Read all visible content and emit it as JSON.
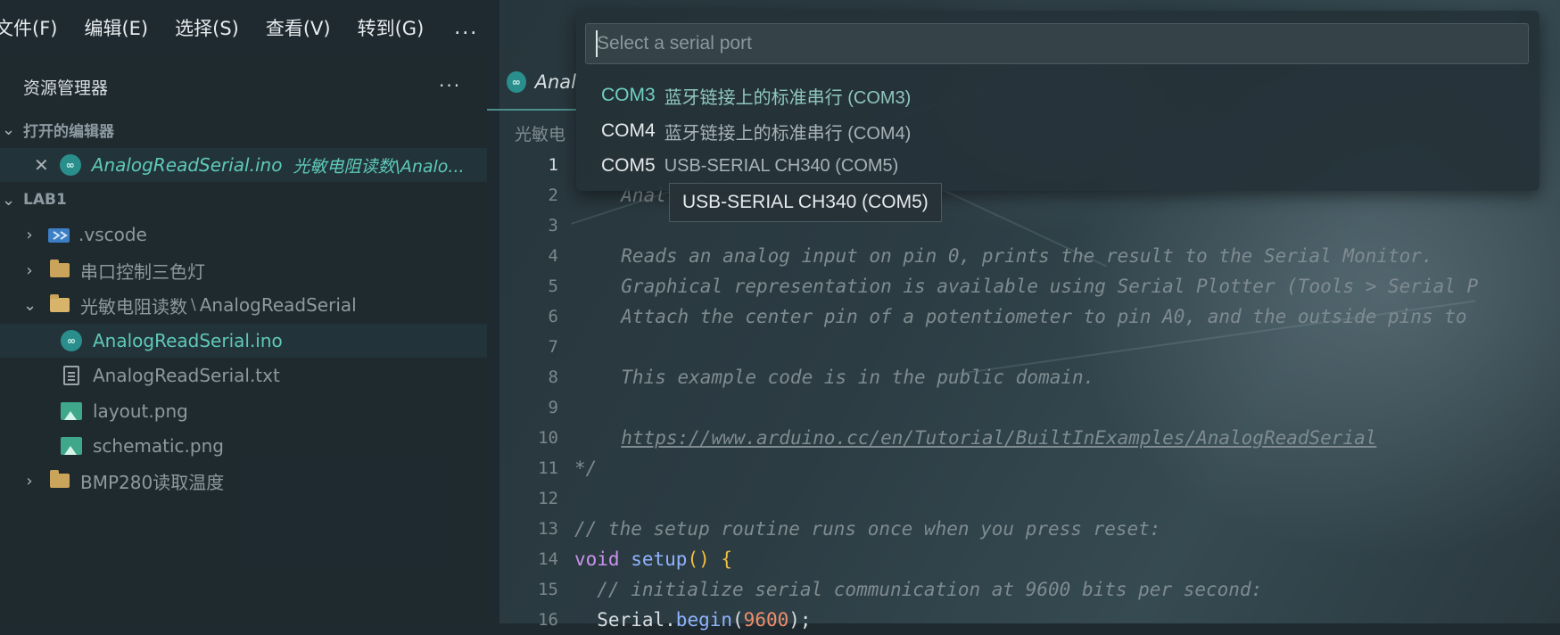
{
  "menubar": {
    "items": [
      "文件(F)",
      "编辑(E)",
      "选择(S)",
      "查看(V)",
      "转到(G)"
    ],
    "more": "..."
  },
  "explorer": {
    "title": "资源管理器",
    "more": "...",
    "open_editors_title": "打开的编辑器",
    "open_editor": {
      "file": "AnalogReadSerial.ino",
      "path": "光敏电阻读数\\Analo..."
    },
    "workspace_title": "LAB1",
    "tree": [
      {
        "label": ".vscode",
        "icon": "vscode-folder-icon"
      },
      {
        "label": "串口控制三色灯",
        "icon": "folder-icon"
      },
      {
        "label": "光敏电阻读数",
        "sep": "\\",
        "label2": "AnalogReadSerial",
        "icon": "folder-open-icon"
      },
      {
        "label": "AnalogReadSerial.ino",
        "icon": "arduino-icon"
      },
      {
        "label": "AnalogReadSerial.txt",
        "icon": "text-file-icon"
      },
      {
        "label": "layout.png",
        "icon": "image-icon"
      },
      {
        "label": "schematic.png",
        "icon": "image-icon"
      },
      {
        "label": "BMP280读取温度",
        "icon": "folder-icon"
      }
    ]
  },
  "tabs": [
    {
      "label": "Anal"
    }
  ],
  "breadcrumb": "光敏电",
  "editor": {
    "line_numbers": [
      "1",
      "2",
      "3",
      "4",
      "5",
      "6",
      "7",
      "8",
      "9",
      "10",
      "11",
      "12",
      "13",
      "14",
      "15",
      "16"
    ],
    "lines": {
      "l2": "  Anal",
      "l4": "  Reads an analog input on pin 0, prints the result to the Serial Monitor.",
      "l5": "  Graphical representation is available using Serial Plotter (Tools > Serial P",
      "l6": "  Attach the center pin of a potentiometer to pin A0, and the outside pins to",
      "l8": "  This example code is in the public domain.",
      "l10": "https://www.arduino.cc/en/Tutorial/BuiltInExamples/AnalogReadSerial",
      "l11": "*/",
      "l13": "// the setup routine runs once when you press reset:",
      "l14_kw": "void",
      "l14_fn": "setup",
      "l14_paren": "()",
      "l14_brace": "{",
      "l15": "  // initialize serial communication at 9600 bits per second:",
      "l16_id": "  Serial.",
      "l16_fn": "begin",
      "l16_open": "(",
      "l16_num": "9600",
      "l16_close": ");"
    }
  },
  "quickpick": {
    "placeholder": "Select a serial port",
    "items": [
      {
        "name": "COM3",
        "desc": "蓝牙链接上的标准串行 (COM3)"
      },
      {
        "name": "COM4",
        "desc": "蓝牙链接上的标准串行 (COM4)"
      },
      {
        "name": "COM5",
        "desc": "USB-SERIAL CH340 (COM5)"
      }
    ],
    "tooltip": "USB-SERIAL CH340 (COM5)"
  },
  "colors": {
    "accent": "#5fc9b9",
    "background": "#1f2a30"
  }
}
